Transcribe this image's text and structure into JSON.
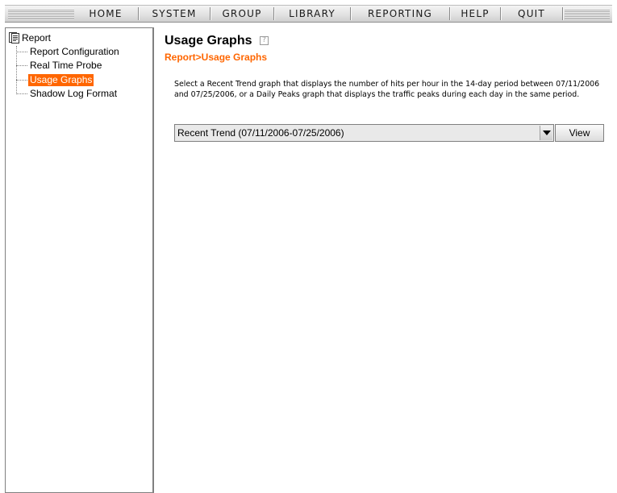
{
  "menu": {
    "items": [
      {
        "label": "HOME"
      },
      {
        "label": "SYSTEM"
      },
      {
        "label": "GROUP"
      },
      {
        "label": "LIBRARY"
      },
      {
        "label": "REPORTING"
      },
      {
        "label": "HELP"
      },
      {
        "label": "QUIT"
      }
    ]
  },
  "tree": {
    "root_label": "Report",
    "items": [
      {
        "label": "Report Configuration",
        "selected": false
      },
      {
        "label": "Real Time Probe",
        "selected": false
      },
      {
        "label": "Usage Graphs",
        "selected": true
      },
      {
        "label": "Shadow Log Format",
        "selected": false
      }
    ]
  },
  "main": {
    "title": "Usage Graphs",
    "help_glyph": "?",
    "breadcrumb": "Report>Usage Graphs",
    "description": "Select a Recent Trend graph that displays the number of hits per hour in the 14-day period between 07/11/2006 and 07/25/2006, or a Daily Peaks graph that displays the traffic peaks during each day in the same period.",
    "graph_select": {
      "selected": "Recent Trend (07/11/2006-07/25/2006)"
    },
    "view_label": "View"
  },
  "colors": {
    "accent": "#ff6600",
    "selection_bg": "#ff6600",
    "selection_text": "#ffffff"
  },
  "icons": {
    "tree_root": "report-document-icon",
    "help": "help-question-icon",
    "dropdown": "chevron-down-icon"
  }
}
